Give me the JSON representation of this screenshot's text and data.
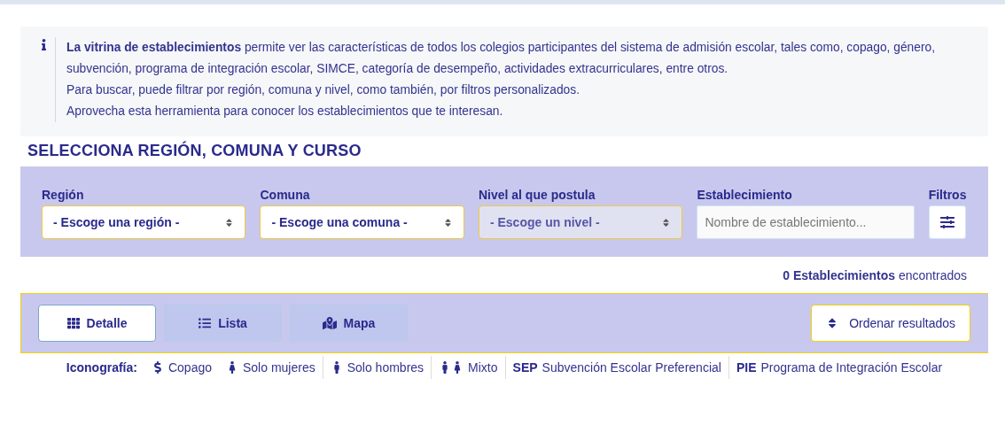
{
  "info": {
    "paragraphs": [
      "**La vitrina de establecimientos** permite ver las características de todos los colegios participantes del sistema de admisión escolar, tales como, copago, género, subvención, programa de integración escolar, SIMCE, categoría de desempeño, actividades extracurriculares, entre otros.",
      "Para buscar, puede filtrar por región, comuna y nivel, como también, por filtros personalizados.",
      "Aprovecha esta herramienta para conocer los establecimientos que te interesan."
    ]
  },
  "heading": "SELECCIONA REGIÓN, COMUNA Y CURSO",
  "filters": [
    {
      "kind": "select",
      "label": "Región",
      "value": "- Escoge una región -",
      "disabled": false
    },
    {
      "kind": "select",
      "label": "Comuna",
      "value": "- Escoge una comuna -",
      "disabled": false
    },
    {
      "kind": "select",
      "label": "Nivel al que postula",
      "value": "- Escoge un nivel -",
      "disabled": true
    },
    {
      "kind": "input",
      "label": "Establecimiento",
      "placeholder": "Nombre de establecimiento..."
    },
    {
      "kind": "button",
      "label": "Filtros"
    }
  ],
  "count": "**0 Establecimientos** encontrados",
  "views": [
    {
      "label": "Detalle",
      "selected": true
    },
    {
      "label": "Lista",
      "selected": false
    },
    {
      "label": "Mapa",
      "selected": false
    }
  ],
  "sort_button": "Ordenar resultados",
  "legend": {
    "title": "Iconografía:",
    "items": [
      {
        "kind": "icon",
        "label": "Copago"
      },
      {
        "kind": "icon",
        "label": "Solo mujeres"
      },
      {
        "kind": "icon",
        "label": "Solo hombres"
      },
      {
        "kind": "icon",
        "label": "Mixto"
      },
      {
        "kind": "abbr",
        "abbr": "SEP",
        "label": "Subvención Escolar Preferencial"
      },
      {
        "kind": "abbr",
        "abbr": "PIE",
        "label": "Programa de Integración Escolar"
      }
    ]
  }
}
